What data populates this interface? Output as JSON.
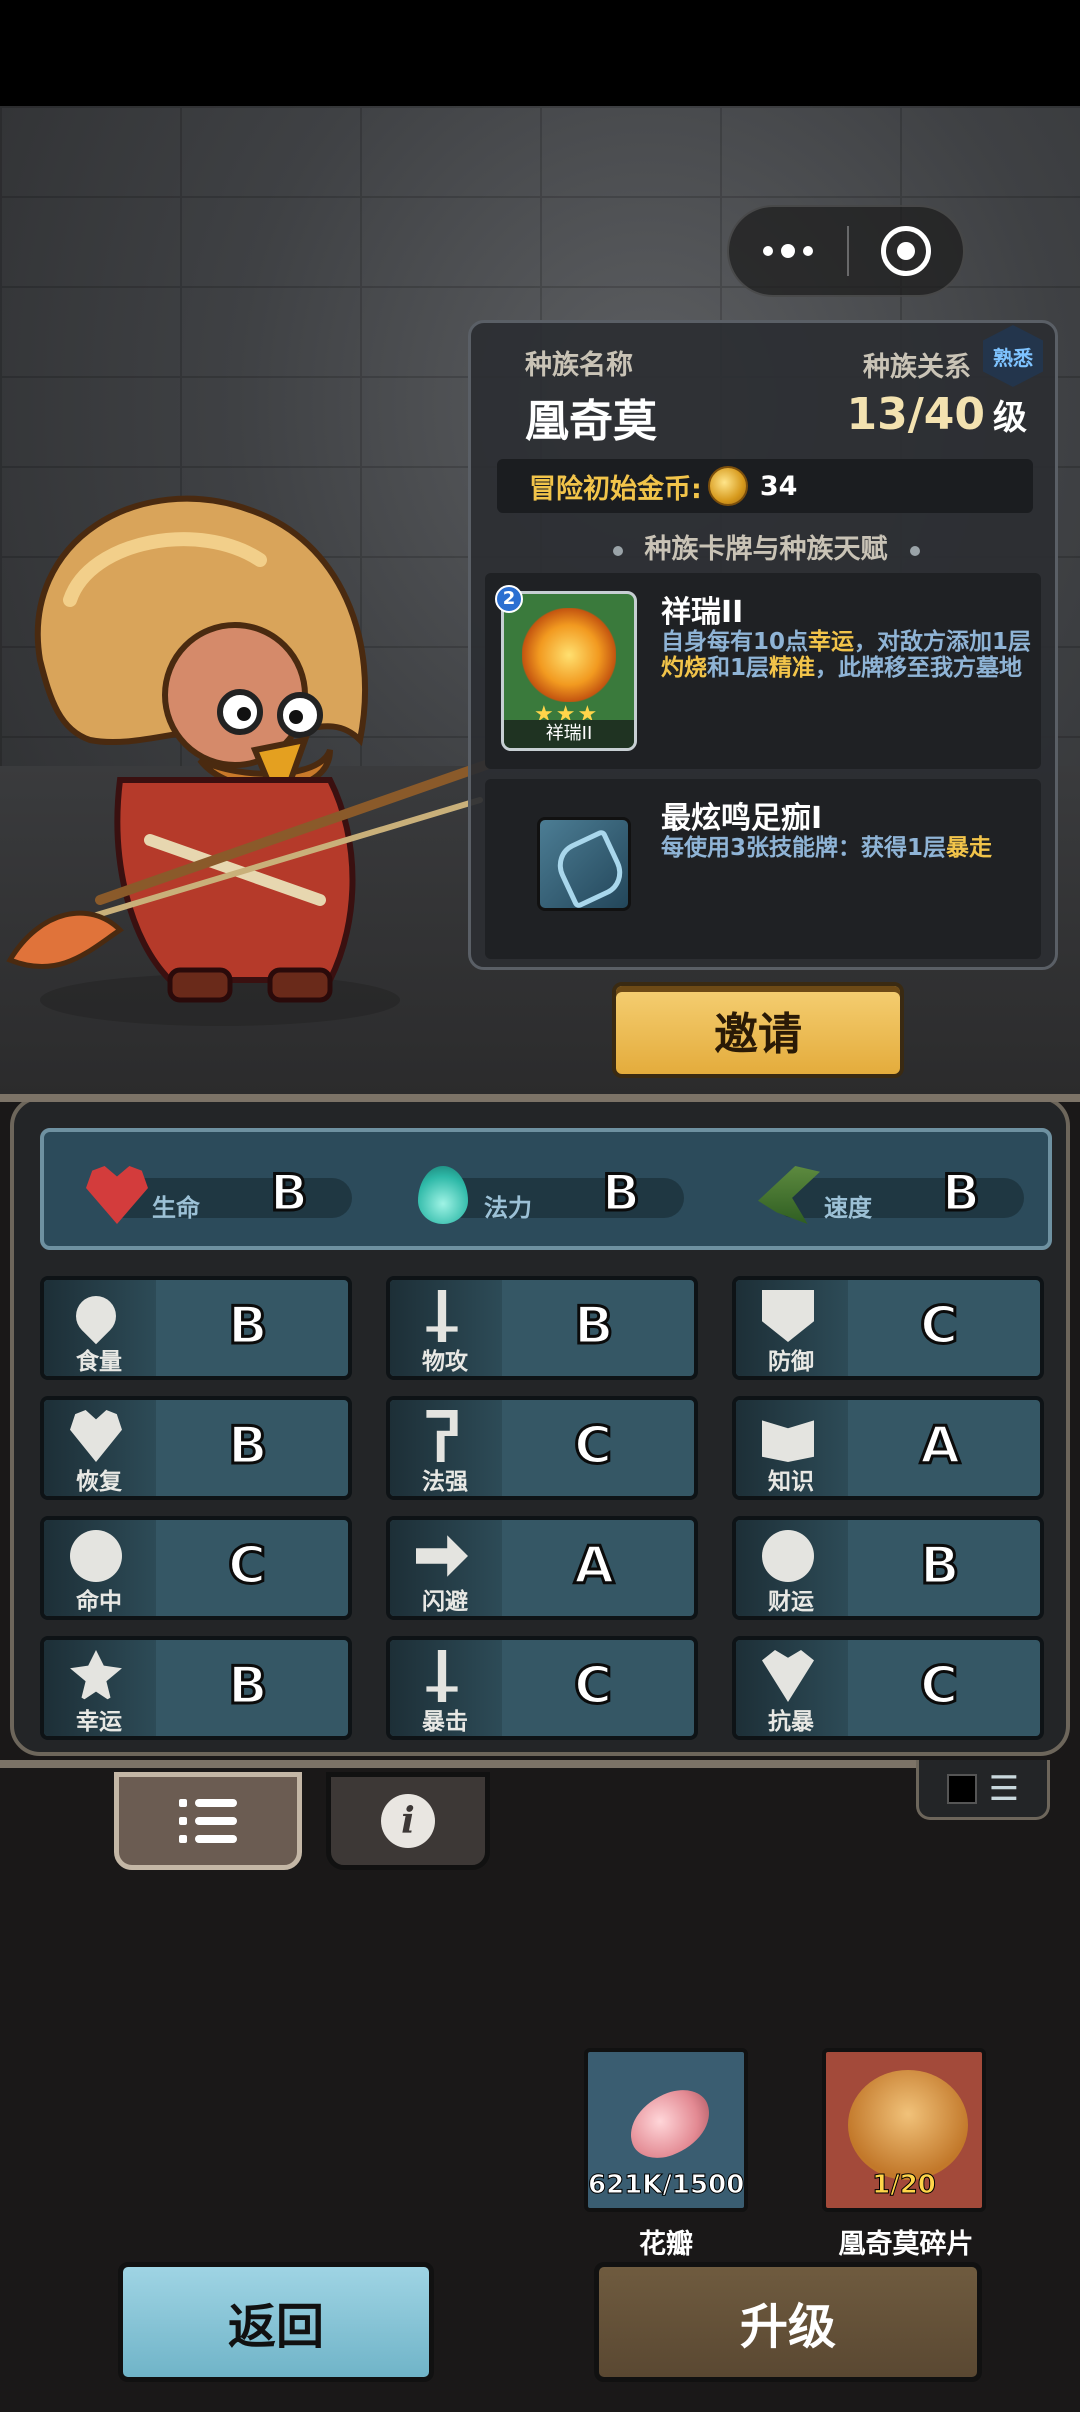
{
  "race": {
    "name_label": "种族名称",
    "name": "凰奇莫",
    "relation_label": "种族关系",
    "relation": "熟悉",
    "level": "13/40",
    "level_unit": "级",
    "gold_label": "冒险初始金币:",
    "gold_value": "34",
    "section_title": "种族卡牌与种族天赋"
  },
  "cards": [
    {
      "badge": "2",
      "thumb_label": "祥瑞II",
      "name": "祥瑞II",
      "desc_parts": [
        "自身每有10点",
        "幸运",
        "，对敌方添加1层",
        "灼烧",
        "和1层",
        "精准",
        "，此牌移至我方墓地"
      ]
    },
    {
      "name": "最炫鸣足痂I",
      "desc_parts": [
        "每使用3张技能牌：获得1层",
        "暴走"
      ]
    }
  ],
  "invite_label": "邀请",
  "main_stats": [
    {
      "name": "生命",
      "grade": "B",
      "icon": "heart-icon"
    },
    {
      "name": "法力",
      "grade": "B",
      "icon": "mana-flame-icon"
    },
    {
      "name": "速度",
      "grade": "B",
      "icon": "wing-boot-icon"
    }
  ],
  "attributes": [
    {
      "name": "食量",
      "grade": "B",
      "icon": "stomach-icon"
    },
    {
      "name": "物攻",
      "grade": "B",
      "icon": "sword-icon"
    },
    {
      "name": "防御",
      "grade": "C",
      "icon": "armor-icon"
    },
    {
      "name": "恢复",
      "grade": "B",
      "icon": "heal-heart-icon"
    },
    {
      "name": "法强",
      "grade": "C",
      "icon": "staff-icon"
    },
    {
      "name": "知识",
      "grade": "A",
      "icon": "book-icon"
    },
    {
      "name": "命中",
      "grade": "C",
      "icon": "target-icon"
    },
    {
      "name": "闪避",
      "grade": "A",
      "icon": "dodge-arrow-icon"
    },
    {
      "name": "财运",
      "grade": "B",
      "icon": "coin-icon"
    },
    {
      "name": "幸运",
      "grade": "B",
      "icon": "clover-icon"
    },
    {
      "name": "暴击",
      "grade": "C",
      "icon": "crit-icon"
    },
    {
      "name": "抗暴",
      "grade": "C",
      "icon": "crit-resist-icon"
    }
  ],
  "items": [
    {
      "name": "花瓣",
      "count": "621K/1500"
    },
    {
      "name": "凰奇莫碎片",
      "count": "1/20"
    }
  ],
  "buttons": {
    "back": "返回",
    "upgrade": "升级"
  },
  "colors": {
    "accent_gold": "#f2c44a",
    "desc_blue": "#8fb4d6",
    "panel_teal": "#355765"
  }
}
